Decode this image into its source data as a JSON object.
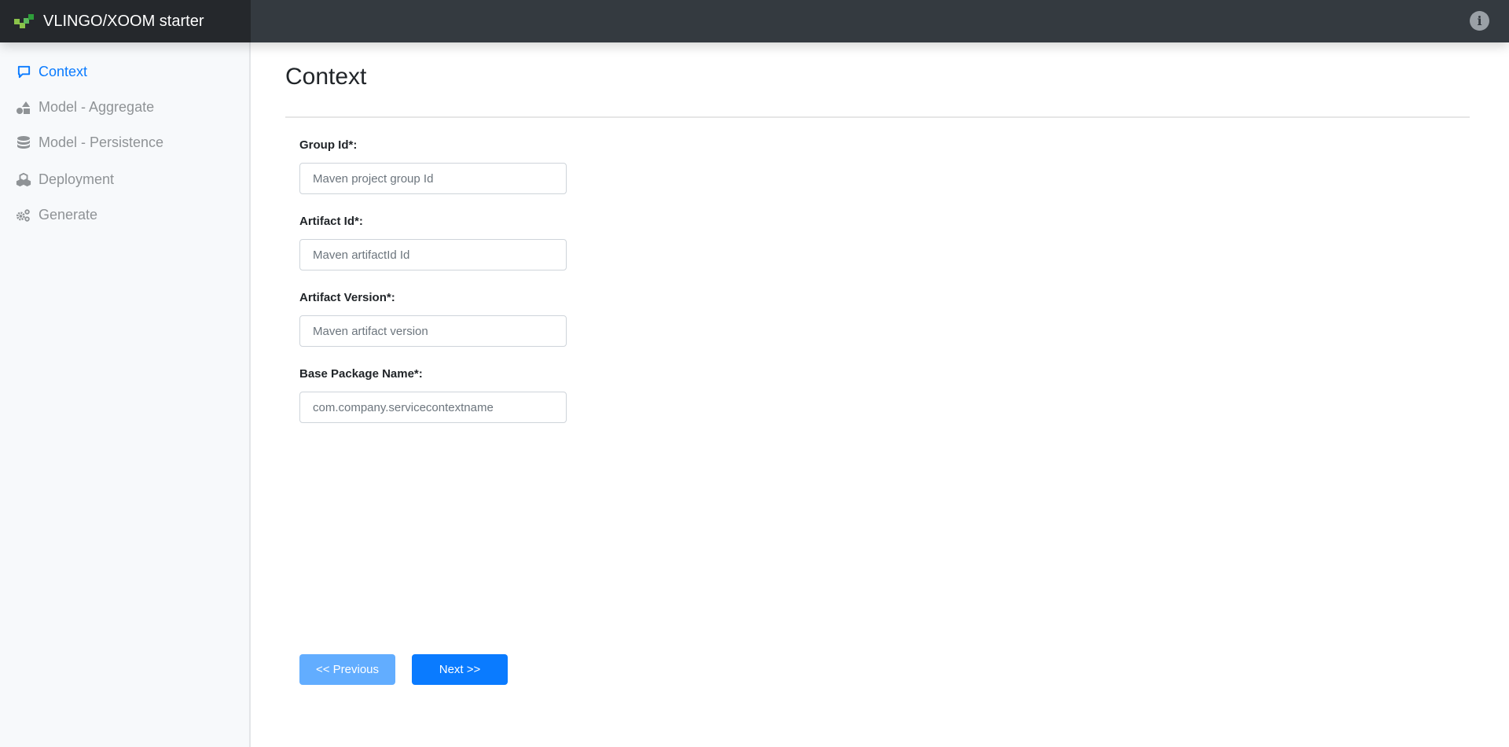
{
  "header": {
    "title": "VLINGO/XOOM starter",
    "logo_color_light": "#8bc34a",
    "logo_color_dark": "#2e9e3a",
    "info_icon": "info-circle-icon"
  },
  "sidebar": {
    "items": [
      {
        "label": "Context",
        "icon": "comment-icon",
        "active": true
      },
      {
        "label": "Model - Aggregate",
        "icon": "shapes-icon",
        "active": false
      },
      {
        "label": "Model - Persistence",
        "icon": "database-icon",
        "active": false
      },
      {
        "label": "Deployment",
        "icon": "cubes-icon",
        "active": false
      },
      {
        "label": "Generate",
        "icon": "cogs-icon",
        "active": false
      }
    ]
  },
  "main": {
    "title": "Context",
    "fields": [
      {
        "label": "Group Id*:",
        "value": "",
        "placeholder": "Maven project group Id"
      },
      {
        "label": "Artifact Id*:",
        "value": "",
        "placeholder": "Maven artifactId Id"
      },
      {
        "label": "Artifact Version*:",
        "value": "",
        "placeholder": "Maven artifact version"
      },
      {
        "label": "Base Package Name*:",
        "value": "",
        "placeholder": "com.company.servicecontextname"
      }
    ],
    "previous_label": "<< Previous",
    "next_label": "Next >>"
  },
  "colors": {
    "accent": "#0a7bff",
    "accent_disabled": "#62adff",
    "header_bg": "#343a40",
    "brand_bg": "#25282c"
  }
}
